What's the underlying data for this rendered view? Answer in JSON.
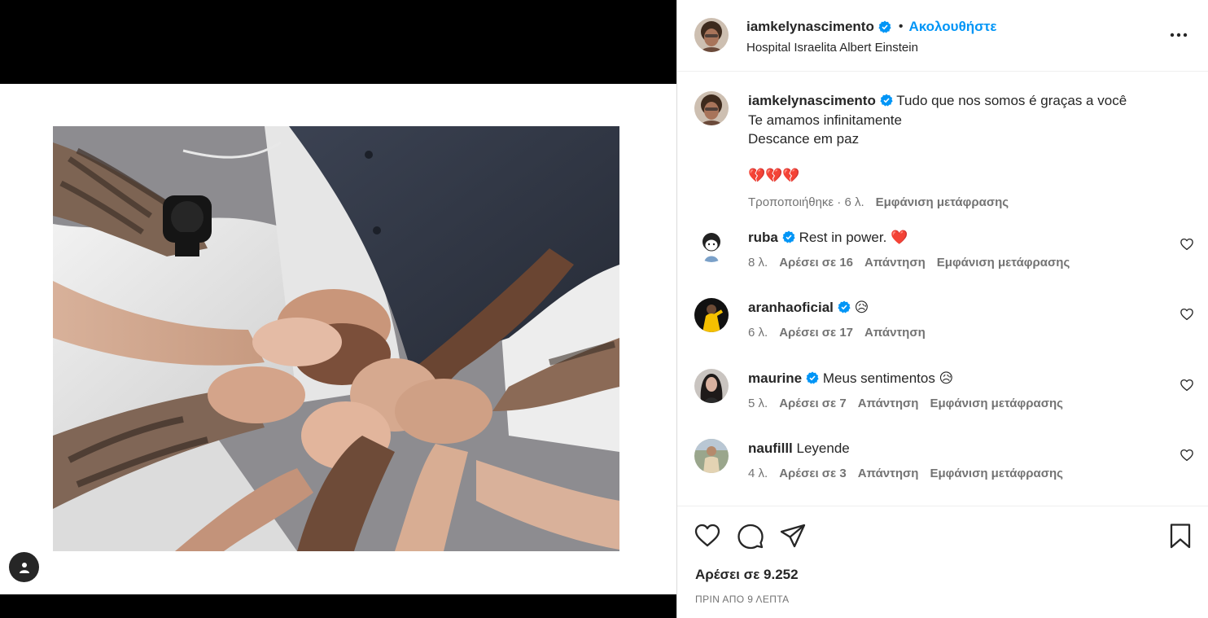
{
  "post": {
    "username": "iamkelynascimento",
    "follow_label": "Ακολουθήστε",
    "separator": "•",
    "location": "Hospital Israelita Albert Einstein"
  },
  "caption": {
    "username": "iamkelynascimento",
    "line1": "Tudo que nos somos é graças a você",
    "line2": "Te amamos infinitamente",
    "line3": "Descance em paz",
    "hearts": "💔💔💔",
    "edited": "Τροποποιήθηκε · 6 λ.",
    "see_translation": "Εμφάνιση μετάφρασης"
  },
  "comments": [
    {
      "username": "ruba",
      "text": "Rest in power. ❤️",
      "time": "8 λ.",
      "likes": "Αρέσει σε 16",
      "reply": "Απάντηση",
      "translate": "Εμφάνιση μετάφρασης",
      "verified": true
    },
    {
      "username": "aranhaoficial",
      "text": "😥",
      "time": "6 λ.",
      "likes": "Αρέσει σε 17",
      "reply": "Απάντηση",
      "translate": "",
      "verified": true
    },
    {
      "username": "maurine",
      "text": "Meus sentimentos 😥",
      "time": "5 λ.",
      "likes": "Αρέσει σε 7",
      "reply": "Απάντηση",
      "translate": "Εμφάνιση μετάφρασης",
      "verified": true
    },
    {
      "username": "naufilll",
      "text": "Leyende",
      "time": "4 λ.",
      "likes": "Αρέσει σε 3",
      "reply": "Απάντηση",
      "translate": "Εμφάνιση μετάφρασης",
      "verified": false
    }
  ],
  "actions": {
    "likes": "Αρέσει σε 9.252",
    "time_ago": "ΠΡΙΝ ΑΠΟ 9 ΛΕΠΤΑ"
  },
  "icons": {
    "like": "heart-outline-icon",
    "comment": "speech-bubble-icon",
    "share": "paper-plane-icon",
    "save": "bookmark-icon",
    "more": "ellipsis-icon",
    "user_tag": "person-icon",
    "verified": "verified-badge-icon"
  },
  "colors": {
    "link_blue": "#0095f6",
    "verified_blue": "#0095f6",
    "muted_text": "#737373",
    "heart_red": "#ed4956"
  }
}
